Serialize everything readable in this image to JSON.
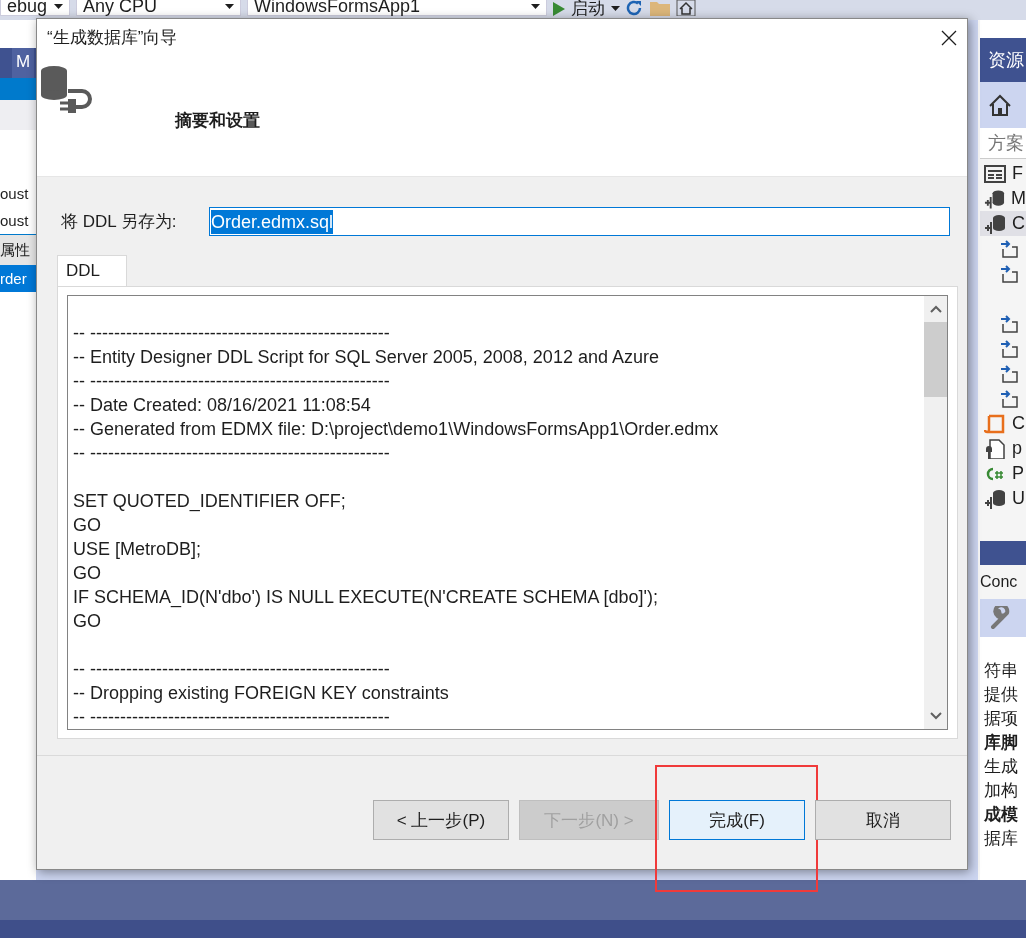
{
  "ide": {
    "toolbar": {
      "configuration": "ebug",
      "platform": "Any CPU",
      "project": "WindowsFormsApp1",
      "start": "启动"
    },
    "left_panel": {
      "tab": "M",
      "items": [
        {
          "label": "oust",
          "selected": false
        },
        {
          "label": "oust",
          "selected": false
        },
        {
          "label": "属性",
          "kind": "header",
          "selected": false
        },
        {
          "label": "rder",
          "selected": true
        }
      ]
    },
    "solution_explorer": {
      "title": "资源",
      "search": "方案",
      "tree": [
        {
          "kind": "form",
          "label": "F"
        },
        {
          "kind": "model",
          "label": "M"
        },
        {
          "kind": "model",
          "label": "C",
          "selected": true
        },
        {
          "kind": "reference"
        },
        {
          "kind": "reference"
        },
        {
          "kind": "gap"
        },
        {
          "kind": "reference"
        },
        {
          "kind": "reference"
        },
        {
          "kind": "reference"
        },
        {
          "kind": "reference"
        },
        {
          "kind": "config",
          "label": "C"
        },
        {
          "kind": "settings",
          "label": "p"
        },
        {
          "kind": "csharp",
          "label": "P"
        },
        {
          "kind": "model",
          "label": "U"
        }
      ]
    },
    "properties": {
      "title": "Conc",
      "rows": [
        {
          "text": "符串",
          "bold": false
        },
        {
          "text": "提供",
          "bold": false
        },
        {
          "text": "据项",
          "bold": false
        },
        {
          "text": "库脚",
          "bold": true
        },
        {
          "text": "生成",
          "bold": false
        },
        {
          "text": "加构",
          "bold": false
        },
        {
          "text": "成模",
          "bold": true
        },
        {
          "text": "据库",
          "bold": false
        }
      ]
    }
  },
  "dialog": {
    "title": "“生成数据库”向导",
    "subtitle": "摘要和设置",
    "save_label": "将 DDL 另存为:",
    "save_value": "Order.edmx.sql",
    "tabs": [
      {
        "label": "DDL",
        "selected": true
      }
    ],
    "script_blocks": [
      [
        "-- --------------------------------------------------",
        "-- Entity Designer DDL Script for SQL Server 2005, 2008, 2012 and Azure",
        "-- --------------------------------------------------",
        "-- Date Created: 08/16/2021 11:08:54",
        "-- Generated from EDMX file: D:\\project\\demo1\\WindowsFormsApp1\\Order.edmx",
        "-- --------------------------------------------------"
      ],
      [
        "SET QUOTED_IDENTIFIER OFF;",
        "GO",
        "USE [MetroDB];",
        "GO",
        "IF SCHEMA_ID(N'dbo') IS NULL EXECUTE(N'CREATE SCHEMA [dbo]');",
        "GO"
      ],
      [
        "-- --------------------------------------------------",
        "-- Dropping existing FOREIGN KEY constraints",
        "-- --------------------------------------------------"
      ]
    ],
    "buttons": [
      {
        "label": "< 上一步(P)",
        "disabled": false,
        "focused": false,
        "highlighted": false
      },
      {
        "label": "下一步(N) >",
        "disabled": true,
        "focused": false,
        "highlighted": false
      },
      {
        "label": "完成(F)",
        "disabled": false,
        "focused": true,
        "highlighted": true
      },
      {
        "label": "取消",
        "disabled": false,
        "focused": false,
        "highlighted": false
      }
    ]
  }
}
